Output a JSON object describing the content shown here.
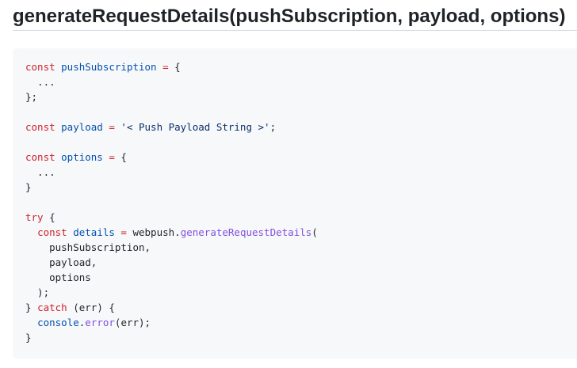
{
  "heading": {
    "title": "generateRequestDetails(pushSubscription, payload, options)"
  },
  "code": {
    "language": "javascript",
    "lines": [
      [
        {
          "t": "kw",
          "v": "const "
        },
        {
          "t": "def",
          "v": "pushSubscription"
        },
        {
          "t": "op",
          "v": " = "
        },
        {
          "t": "plain",
          "v": "{"
        }
      ],
      [
        {
          "t": "plain",
          "v": "  ..."
        }
      ],
      [
        {
          "t": "plain",
          "v": "};"
        }
      ],
      [],
      [
        {
          "t": "kw",
          "v": "const "
        },
        {
          "t": "def",
          "v": "payload"
        },
        {
          "t": "op",
          "v": " = "
        },
        {
          "t": "str",
          "v": "'< Push Payload String >'"
        },
        {
          "t": "plain",
          "v": ";"
        }
      ],
      [],
      [
        {
          "t": "kw",
          "v": "const "
        },
        {
          "t": "def",
          "v": "options"
        },
        {
          "t": "op",
          "v": " = "
        },
        {
          "t": "plain",
          "v": "{"
        }
      ],
      [
        {
          "t": "plain",
          "v": "  ..."
        }
      ],
      [
        {
          "t": "plain",
          "v": "}"
        }
      ],
      [],
      [
        {
          "t": "kw",
          "v": "try"
        },
        {
          "t": "plain",
          "v": " {"
        }
      ],
      [
        {
          "t": "plain",
          "v": "  "
        },
        {
          "t": "kw",
          "v": "const "
        },
        {
          "t": "def",
          "v": "details"
        },
        {
          "t": "op",
          "v": " = "
        },
        {
          "t": "plain",
          "v": "webpush."
        },
        {
          "t": "fn",
          "v": "generateRequestDetails"
        },
        {
          "t": "plain",
          "v": "("
        }
      ],
      [
        {
          "t": "plain",
          "v": "    pushSubscription,"
        }
      ],
      [
        {
          "t": "plain",
          "v": "    payload,"
        }
      ],
      [
        {
          "t": "plain",
          "v": "    options"
        }
      ],
      [
        {
          "t": "plain",
          "v": "  );"
        }
      ],
      [
        {
          "t": "plain",
          "v": "} "
        },
        {
          "t": "kw",
          "v": "catch"
        },
        {
          "t": "plain",
          "v": " (err) {"
        }
      ],
      [
        {
          "t": "plain",
          "v": "  "
        },
        {
          "t": "def",
          "v": "console"
        },
        {
          "t": "plain",
          "v": "."
        },
        {
          "t": "fn",
          "v": "error"
        },
        {
          "t": "plain",
          "v": "(err);"
        }
      ],
      [
        {
          "t": "plain",
          "v": "}"
        }
      ]
    ]
  },
  "colors": {
    "keyword": "#cf222e",
    "definition": "#0550ae",
    "string": "#0a3069",
    "function": "#8250df",
    "text": "#1f2328",
    "code_background": "#f6f8fa"
  }
}
